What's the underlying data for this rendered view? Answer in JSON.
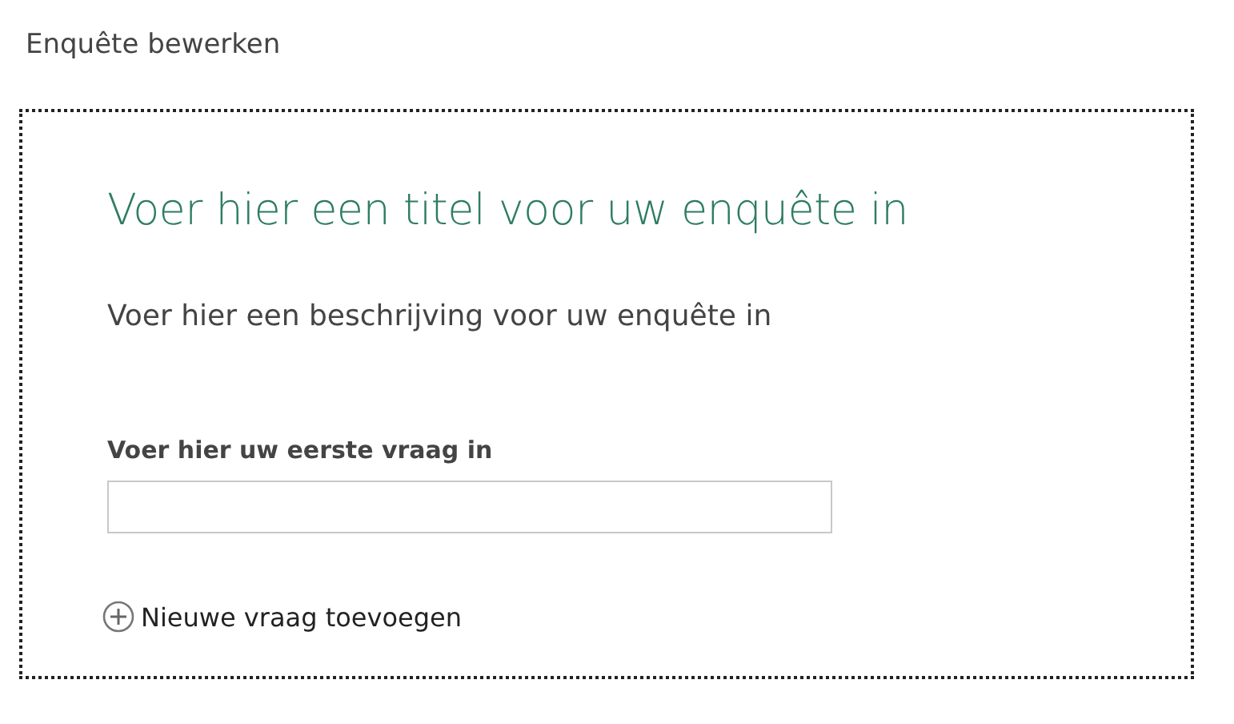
{
  "page_title": "Enquête bewerken",
  "survey": {
    "title": "Voer hier een titel voor uw enquête in",
    "description": "Voer hier een beschrijving voor uw enquête in",
    "questions": [
      {
        "label": "Voer hier uw eerste vraag in"
      }
    ],
    "add_question": "Nieuwe vraag toevoegen"
  }
}
